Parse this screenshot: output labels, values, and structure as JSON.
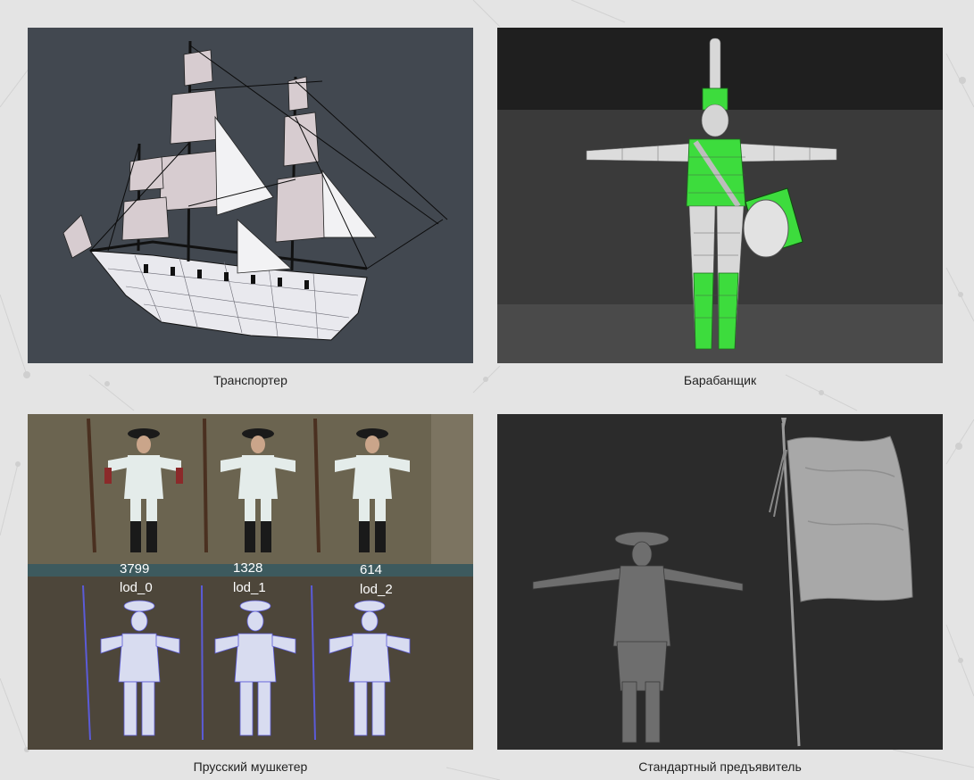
{
  "gallery": {
    "items": [
      {
        "caption": "Транспортер",
        "image": "ship-wireframe"
      },
      {
        "caption": "Барабанщик",
        "image": "drummer-wireframe"
      },
      {
        "caption": "Прусский мушкетер",
        "image": "musketeer-lods"
      },
      {
        "caption": "Стандартный предъявитель",
        "image": "standard-bearer-sculpt"
      }
    ]
  },
  "musketeer": {
    "lods": [
      {
        "count": "3799",
        "name": "lod_0"
      },
      {
        "count": "1328",
        "name": "lod_1"
      },
      {
        "count": "614",
        "name": "lod_2"
      }
    ]
  },
  "colors": {
    "page_bg": "#e4e4e4",
    "caption_text": "#222222",
    "wire_green": "#3ddc3d"
  }
}
